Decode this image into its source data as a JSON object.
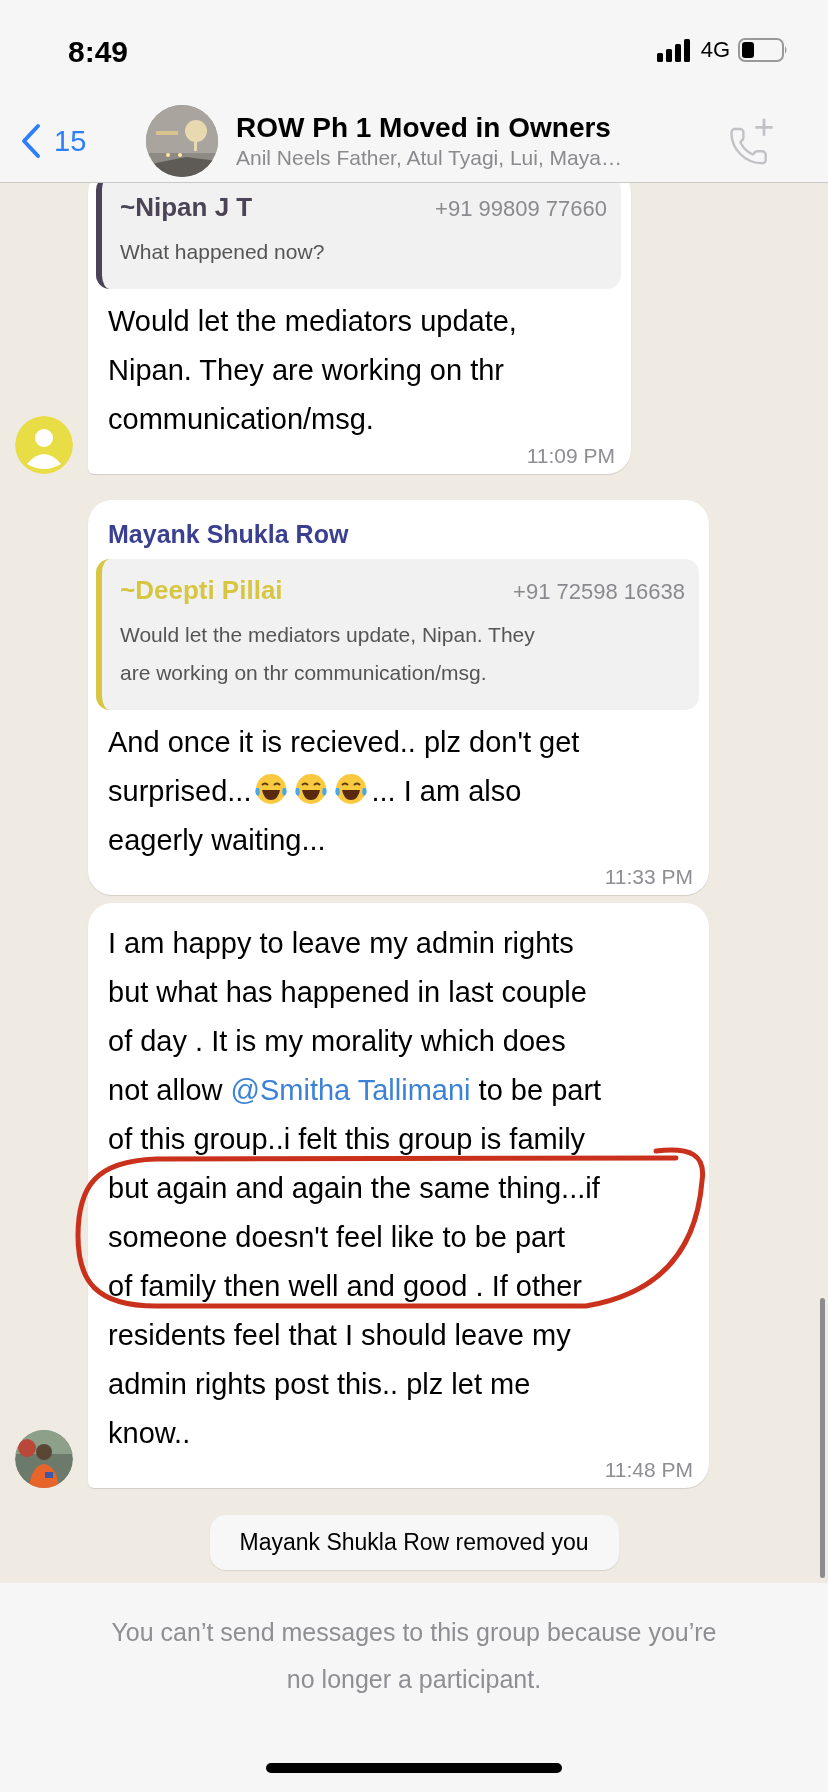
{
  "status_bar": {
    "time": "8:49",
    "network": "4G"
  },
  "header": {
    "back_count": "15",
    "title": "ROW Ph 1 Moved in Owners",
    "subtitle": "Anil Neels Father, Atul Tyagi, Lui, Maya…"
  },
  "messages": [
    {
      "avatar": {
        "kind": "default"
      },
      "tail": true,
      "quote": {
        "name": "~Nipan J T",
        "phone": "+91 99809 77660",
        "text": "What happened now?",
        "color": "#4b4356"
      },
      "segments": [
        {
          "kind": "text",
          "text": "Would let the mediators update,\nNipan. They are working on thr\ncommunication/msg."
        }
      ],
      "time": "11:09 PM"
    },
    {
      "tail": false,
      "sender": "Mayank Shukla Row",
      "quote": {
        "name": "~Deepti Pillai",
        "phone": "+91 72598 16638",
        "text": "Would let the mediators update, Nipan. They\nare working on thr communication/msg.",
        "color": "#d6c642"
      },
      "segments": [
        {
          "kind": "text",
          "text": "And once it is recieved.. plz don't get\nsurprised..."
        },
        {
          "kind": "emoji"
        },
        {
          "kind": "emoji"
        },
        {
          "kind": "emoji"
        },
        {
          "kind": "text",
          "text": "... I am also\neagerly waiting..."
        }
      ],
      "time": "11:33 PM"
    },
    {
      "tail": true,
      "annotated": true,
      "segments": [
        {
          "kind": "text",
          "text": "I am happy to leave my admin rights\nbut what has happened in last couple\nof day . It is my morality which does\nnot allow "
        },
        {
          "kind": "mention",
          "text": "@Smitha Tallimani"
        },
        {
          "kind": "text",
          "text": " to be part\nof this group..i felt this group is family\nbut again and again the same thing...if\nsomeone doesn't feel like to be part\nof family then well and good . If other\nresidents feel that I should leave my\nadmin rights post this.. plz let me\nknow.."
        }
      ],
      "time": "11:48 PM"
    }
  ],
  "system_message": "Mayank Shukla Row removed you",
  "footer": {
    "notice": "You can’t send messages to this group because you’re\nno longer a participant."
  }
}
